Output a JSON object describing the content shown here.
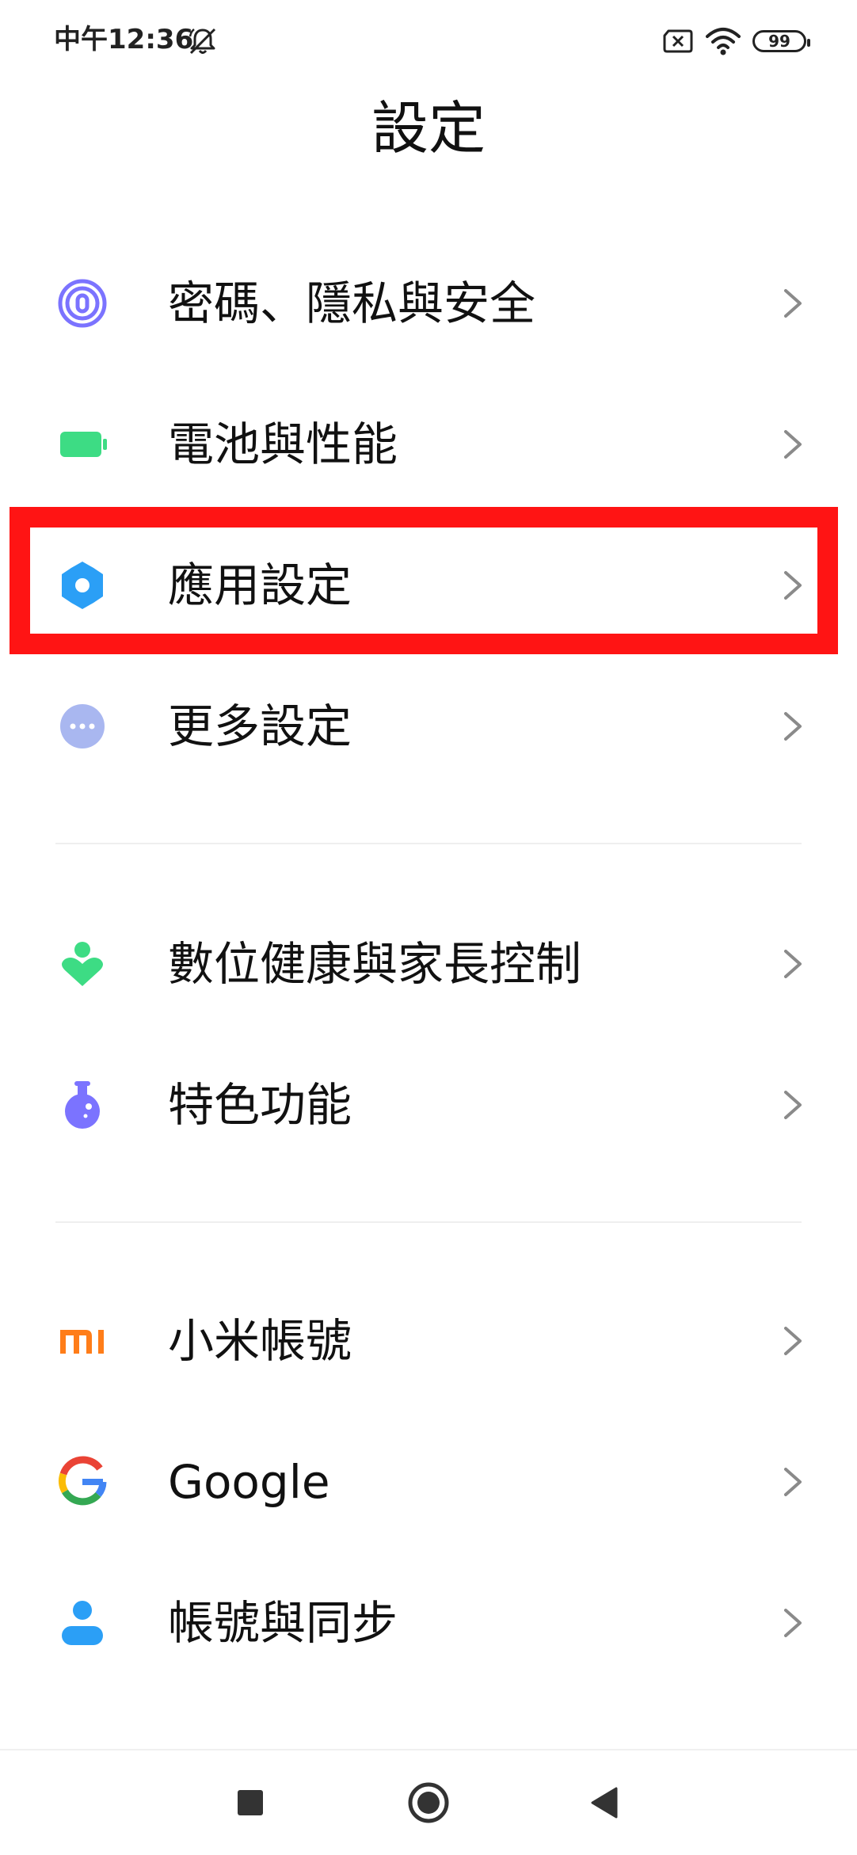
{
  "status_bar": {
    "time": "中午12:36",
    "battery_level": "99",
    "icons": [
      "bell-off-icon",
      "sim-card-icon",
      "wifi-icon",
      "battery-icon"
    ]
  },
  "page": {
    "title": "設定"
  },
  "settings": {
    "items": [
      {
        "label": "密碼、隱私與安全",
        "icon": "fingerprint-icon",
        "color": "#7b73ff"
      },
      {
        "label": "電池與性能",
        "icon": "battery-icon",
        "color": "#3ddc84"
      },
      {
        "label": "應用設定",
        "icon": "gear-icon",
        "color": "#2b9ff6"
      },
      {
        "label": "更多設定",
        "icon": "more-dots-icon",
        "color": "#a9b7f0"
      },
      {
        "label": "數位健康與家長控制",
        "icon": "digital-wellbeing-icon",
        "color": "#3ddc84"
      },
      {
        "label": "特色功能",
        "icon": "potion-flask-icon",
        "color": "#7b73ff"
      },
      {
        "label": "小米帳號",
        "icon": "mi-logo-icon",
        "color": "#ff7d19"
      },
      {
        "label": "Google",
        "icon": "google-g-icon",
        "color": "#4285f4"
      },
      {
        "label": "帳號與同步",
        "icon": "person-icon",
        "color": "#2b9ff6"
      }
    ]
  },
  "highlight": {
    "target": "應用設定",
    "color": "#ff1414"
  },
  "nav_bar": {
    "buttons": [
      "recents-square-icon",
      "home-circle-icon",
      "back-triangle-icon"
    ]
  }
}
